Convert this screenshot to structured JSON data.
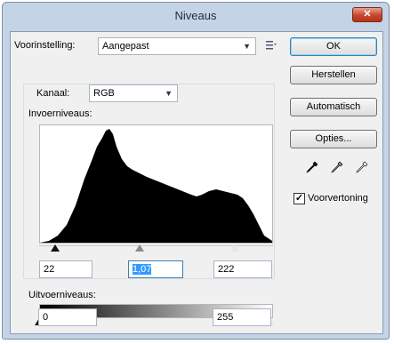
{
  "window": {
    "title": "Niveaus",
    "close_glyph": "✕"
  },
  "preset": {
    "label": "Voorinstelling:",
    "value": "Aangepast",
    "options_icon": "preset-menu-icon"
  },
  "channel": {
    "label": "Kanaal:",
    "value": "RGB"
  },
  "input_levels": {
    "label": "Invoerniveaus:",
    "black": "22",
    "gamma": "1,07",
    "white": "222"
  },
  "output_levels": {
    "label": "Uitvoerniveaus:",
    "black": "0",
    "white": "255"
  },
  "buttons": {
    "ok": "OK",
    "reset": "Herstellen",
    "auto": "Automatisch",
    "options": "Opties..."
  },
  "preview": {
    "label": "Voorvertoning",
    "checked": true
  },
  "icons": {
    "eyedroppers": [
      "black-point-eyedropper-icon",
      "gray-point-eyedropper-icon",
      "white-point-eyedropper-icon"
    ]
  }
}
